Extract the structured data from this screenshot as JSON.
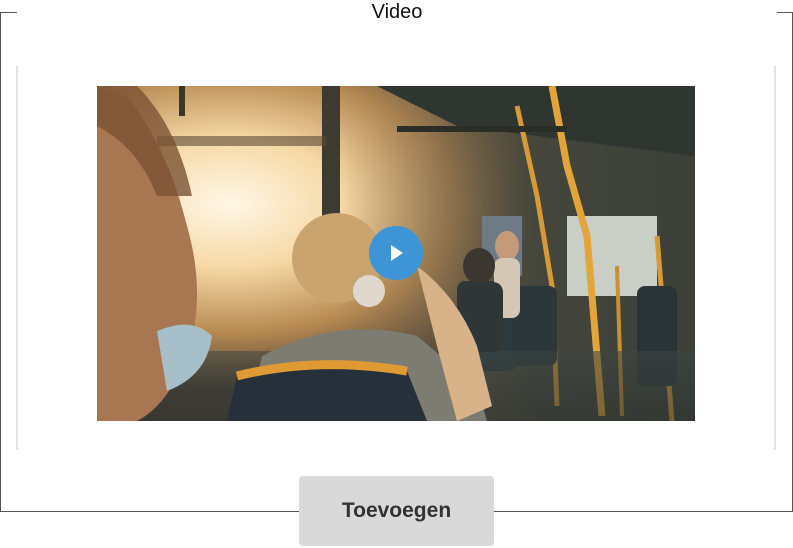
{
  "section": {
    "legend": "Video"
  },
  "video": {
    "play_icon": "play-icon",
    "accent_color": "#3d95d6"
  },
  "actions": {
    "add_label": "Toevoegen"
  }
}
